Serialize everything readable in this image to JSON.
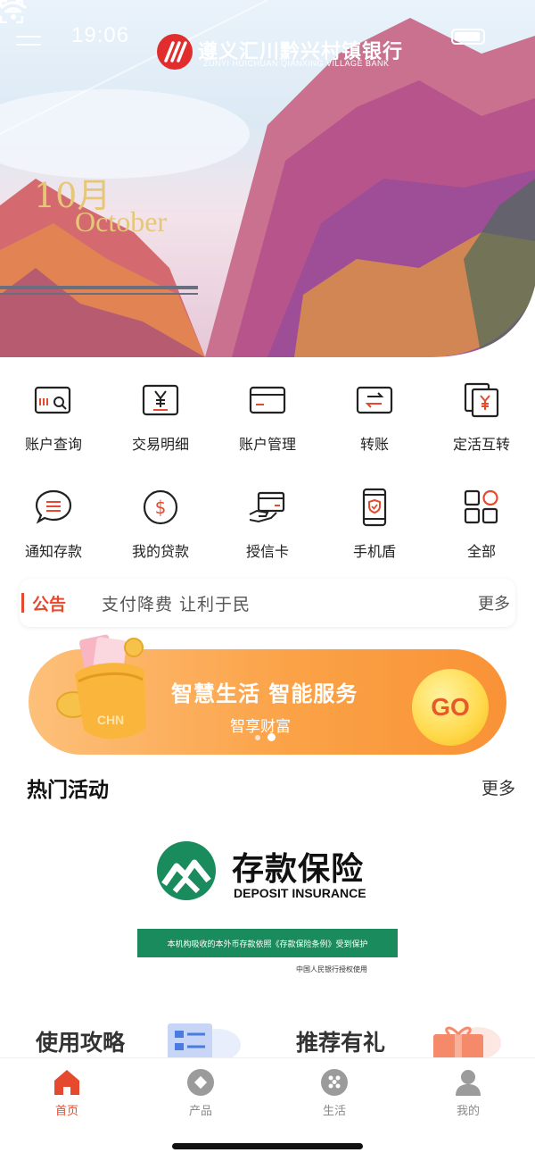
{
  "status_bar": {
    "time": "19:06"
  },
  "header": {
    "bank_name": "遵义汇川黔兴村镇银行",
    "bank_name_en": "ZUNYI HUICHUAN QIANXING VILLAGE BANK"
  },
  "hero": {
    "month_cn": "10月",
    "month_en": "October"
  },
  "grid": {
    "items": [
      {
        "label": "账户查询",
        "icon": "account-query-icon"
      },
      {
        "label": "交易明细",
        "icon": "transaction-detail-icon"
      },
      {
        "label": "账户管理",
        "icon": "account-manage-icon"
      },
      {
        "label": "转账",
        "icon": "transfer-icon"
      },
      {
        "label": "定活互转",
        "icon": "deposit-convert-icon"
      },
      {
        "label": "通知存款",
        "icon": "notice-deposit-icon"
      },
      {
        "label": "我的贷款",
        "icon": "loan-icon"
      },
      {
        "label": "授信卡",
        "icon": "credit-card-icon"
      },
      {
        "label": "手机盾",
        "icon": "phone-shield-icon"
      },
      {
        "label": "全部",
        "icon": "all-apps-icon"
      }
    ]
  },
  "notice": {
    "tag": "公告",
    "text": "支付降费 让利于民",
    "more": "更多"
  },
  "banner": {
    "title": "智慧生活 智能服务",
    "subtitle": "智享财富",
    "go": "GO",
    "coin_text": "CHN"
  },
  "hot": {
    "title": "热门活动",
    "more": "更多",
    "deposit_cn": "存款保险",
    "deposit_en": "DEPOSIT INSURANCE",
    "deposit_strip": "本机构吸收的本外币存款依照《存款保险条例》受到保护",
    "deposit_note": "中国人民银行授权使用"
  },
  "cards": {
    "guide": "使用攻略",
    "refer": "推荐有礼"
  },
  "tabs": [
    {
      "label": "首页",
      "active": true
    },
    {
      "label": "产品",
      "active": false
    },
    {
      "label": "生活",
      "active": false
    },
    {
      "label": "我的",
      "active": false
    }
  ],
  "colors": {
    "accent": "#e64a2e",
    "deposit_green": "#1a8b5c",
    "banner_orange": "#fba247"
  }
}
